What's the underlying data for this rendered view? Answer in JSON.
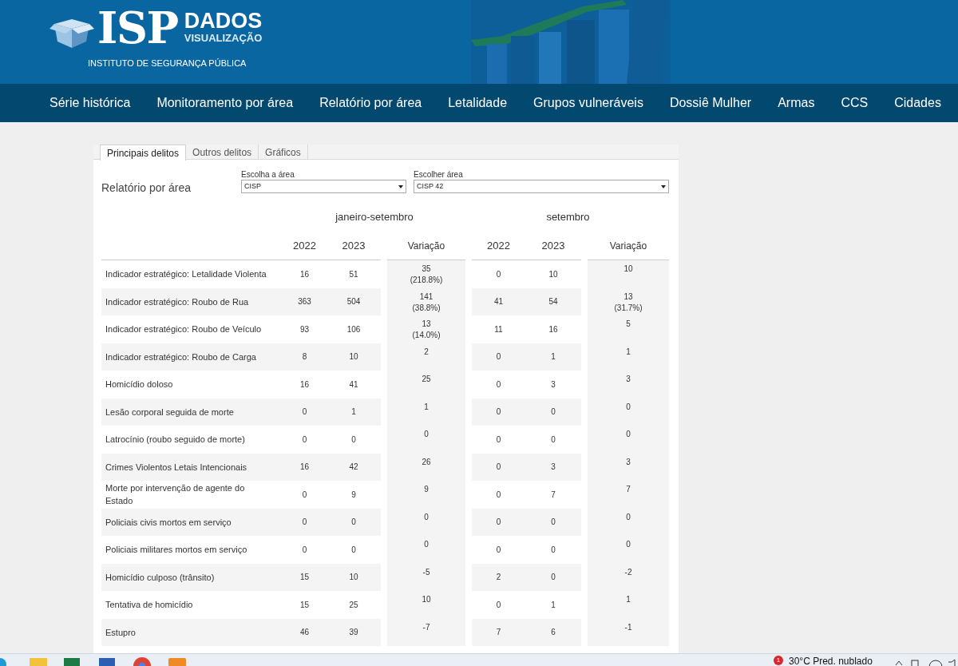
{
  "header": {
    "logo_main": "ISP",
    "logo_title": "DADOS",
    "logo_subtitle": "VISUALIZAÇÃO",
    "institute": "INSTITUTO DE SEGURANÇA PÚBLICA"
  },
  "nav": [
    "Série histórica",
    "Monitoramento por área",
    "Relatório por área",
    "Letalidade",
    "Grupos vulneráveis",
    "Dossiê Mulher",
    "Armas",
    "CCS",
    "Cidades"
  ],
  "tabs": [
    {
      "label": "Principais delitos",
      "selected": true
    },
    {
      "label": "Outros delitos",
      "selected": false
    },
    {
      "label": "Gráficos",
      "selected": false
    }
  ],
  "report_title": "Relatório por área",
  "filters": [
    {
      "label": "Escolha a área",
      "value": "CISP"
    },
    {
      "label": "Escolher área",
      "value": "CISP 42"
    }
  ],
  "periods": [
    "janeiro-setembro",
    "setembro"
  ],
  "columns": [
    "2022",
    "2023",
    "Variação",
    "2022",
    "2023",
    "Variação"
  ],
  "rows": [
    {
      "label": "Indicador estratégico: Letalidade Violenta",
      "values": [
        "16",
        "51"
      ],
      "variation": [
        "35",
        "(218.8%)"
      ],
      "month_values": [
        "0",
        "10"
      ],
      "month_variation": [
        "10"
      ]
    },
    {
      "label": "Indicador estratégico: Roubo de Rua",
      "values": [
        "363",
        "504"
      ],
      "variation": [
        "141",
        "(38.8%)"
      ],
      "month_values": [
        "41",
        "54"
      ],
      "month_variation": [
        "13",
        "(31.7%)"
      ]
    },
    {
      "label": "Indicador estratégico: Roubo de Veículo",
      "values": [
        "93",
        "106"
      ],
      "variation": [
        "13",
        "(14.0%)"
      ],
      "month_values": [
        "11",
        "16"
      ],
      "month_variation": [
        "5"
      ]
    },
    {
      "label": "Indicador estratégico: Roubo de Carga",
      "values": [
        "8",
        "10"
      ],
      "variation": [
        "2"
      ],
      "month_values": [
        "0",
        "1"
      ],
      "month_variation": [
        "1"
      ]
    },
    {
      "label": "Homicídio doloso",
      "values": [
        "16",
        "41"
      ],
      "variation": [
        "25"
      ],
      "month_values": [
        "0",
        "3"
      ],
      "month_variation": [
        "3"
      ]
    },
    {
      "label": "Lesão corporal seguida de morte",
      "values": [
        "0",
        "1"
      ],
      "variation": [
        "1"
      ],
      "month_values": [
        "0",
        "0"
      ],
      "month_variation": [
        "0"
      ]
    },
    {
      "label": "Latrocínio (roubo seguido de morte)",
      "values": [
        "0",
        "0"
      ],
      "variation": [
        "0"
      ],
      "month_values": [
        "0",
        "0"
      ],
      "month_variation": [
        "0"
      ]
    },
    {
      "label": "Crimes Violentos Letais Intencionais",
      "values": [
        "16",
        "42"
      ],
      "variation": [
        "26"
      ],
      "month_values": [
        "0",
        "3"
      ],
      "month_variation": [
        "3"
      ]
    },
    {
      "label": "Morte por intervenção de agente do Estado",
      "values": [
        "0",
        "9"
      ],
      "variation": [
        "9"
      ],
      "month_values": [
        "0",
        "7"
      ],
      "month_variation": [
        "7"
      ]
    },
    {
      "label": "Policiais civis mortos em serviço",
      "values": [
        "0",
        "0"
      ],
      "variation": [
        "0"
      ],
      "month_values": [
        "0",
        "0"
      ],
      "month_variation": [
        "0"
      ]
    },
    {
      "label": "Policiais militares mortos em serviço",
      "values": [
        "0",
        "0"
      ],
      "variation": [
        "0"
      ],
      "month_values": [
        "0",
        "0"
      ],
      "month_variation": [
        "0"
      ]
    },
    {
      "label": "Homicídio culposo (trânsito)",
      "values": [
        "15",
        "10"
      ],
      "variation": [
        "-5"
      ],
      "month_values": [
        "2",
        "0"
      ],
      "month_variation": [
        "-2"
      ]
    },
    {
      "label": "Tentativa de homicídio",
      "values": [
        "15",
        "25"
      ],
      "variation": [
        "10"
      ],
      "month_values": [
        "0",
        "1"
      ],
      "month_variation": [
        "1"
      ]
    },
    {
      "label": "Estupro",
      "values": [
        "46",
        "39"
      ],
      "variation": [
        "-7"
      ],
      "month_values": [
        "7",
        "6"
      ],
      "month_variation": [
        "-1"
      ]
    }
  ],
  "taskbar": {
    "notification_count": "1",
    "weather": "30°C  Pred. nublado"
  }
}
